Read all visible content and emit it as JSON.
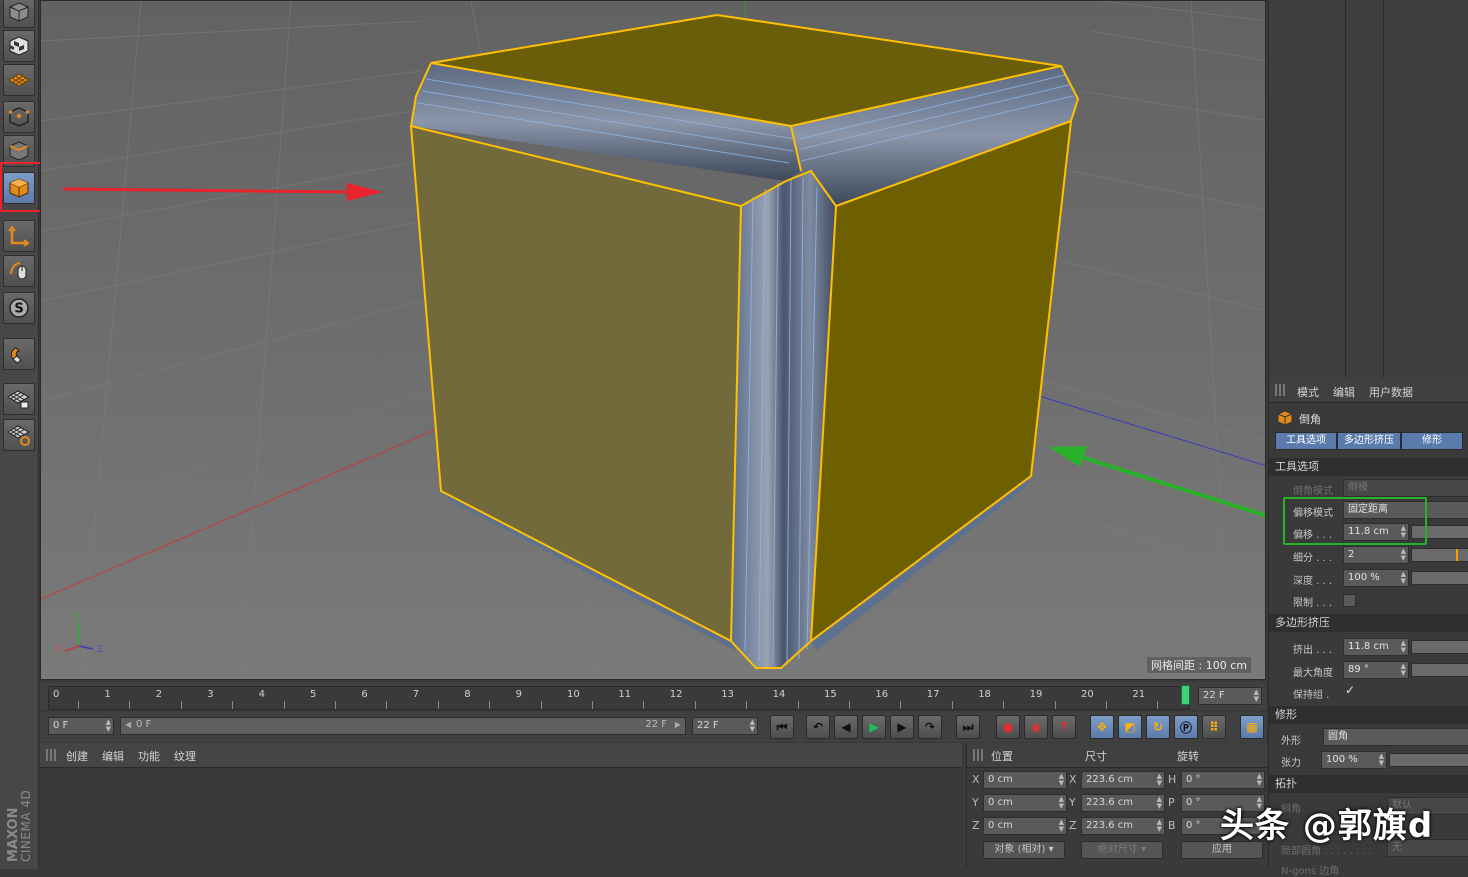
{
  "viewport": {
    "grid_spacing": "网格间距 : 100 cm",
    "axis_labels": {
      "y": "Y",
      "x": "X",
      "z": "Z"
    }
  },
  "timeline": {
    "ticks": [
      "0",
      "1",
      "2",
      "3",
      "4",
      "5",
      "6",
      "7",
      "8",
      "9",
      "10",
      "11",
      "12",
      "13",
      "14",
      "15",
      "16",
      "17",
      "18",
      "19",
      "20",
      "21"
    ],
    "current_frame_field": "22 F",
    "start_field": "0 F",
    "range_start": "0 F",
    "range_end": "22 F",
    "end_field": "22 F"
  },
  "objects_panel": {
    "menu": [
      "创建",
      "编辑",
      "功能",
      "纹理"
    ]
  },
  "coords_panel": {
    "headers": {
      "position": "位置",
      "size": "尺寸",
      "rotation": "旋转"
    },
    "rows": [
      {
        "axis": "X",
        "pos": "0 cm",
        "size_axis": "X",
        "size": "223.6 cm",
        "rot_axis": "H",
        "rot": "0 °"
      },
      {
        "axis": "Y",
        "pos": "0 cm",
        "size_axis": "Y",
        "size": "223.6 cm",
        "rot_axis": "P",
        "rot": "0 °"
      },
      {
        "axis": "Z",
        "pos": "0 cm",
        "size_axis": "Z",
        "size": "223.6 cm",
        "rot_axis": "B",
        "rot": "0 °"
      }
    ],
    "mode_dropdown": "对象 (相对)",
    "size_dropdown": "绝对尺寸",
    "apply_button": "应用"
  },
  "attributes": {
    "menu": [
      "模式",
      "编辑",
      "用户数据"
    ],
    "object_name": "倒角",
    "tabs": [
      "工具选项",
      "多边形挤压",
      "修形"
    ],
    "tool_section": "工具选项",
    "bevel_mode_label": "倒角模式",
    "bevel_mode_value": "倒棱",
    "offset_mode_label": "偏移模式",
    "offset_mode_value": "固定距离",
    "offset_label": "偏移 . . .",
    "offset_value": "11.8 cm",
    "subdivision_label": "细分 . . .",
    "subdivision_value": "2",
    "depth_label": "深度 . . .",
    "depth_value": "100 %",
    "limit_label": "限制 . . .",
    "extrude_section": "多边形挤压",
    "extrude_label": "挤出 . . .",
    "extrude_value": "11.8 cm",
    "max_angle_label": "最大角度",
    "max_angle_value": "89 °",
    "preserve_label": "保持组 .",
    "preserve_value": "✓",
    "shaping_section": "修形",
    "shape_label": "外形",
    "shape_value": "圆角",
    "tension_label": "张力",
    "tension_value": "100 %",
    "topology_section": "拓扑",
    "miter_label": "斜角",
    "miter_value": "默认",
    "local_round_label": "局部圆角 . . . . . . . .",
    "local_round_value": "无",
    "ngon_label": "N-gons 边角"
  },
  "branding": {
    "maxon": "MAXON",
    "product": "CINEMA 4D"
  },
  "watermark": "头条 @郭旗d",
  "colors": {
    "accent_blue": "#5a7bab",
    "annotation_red": "#e8232b",
    "annotation_green": "#2ab12a",
    "selection_yellow": "#ffc000"
  }
}
